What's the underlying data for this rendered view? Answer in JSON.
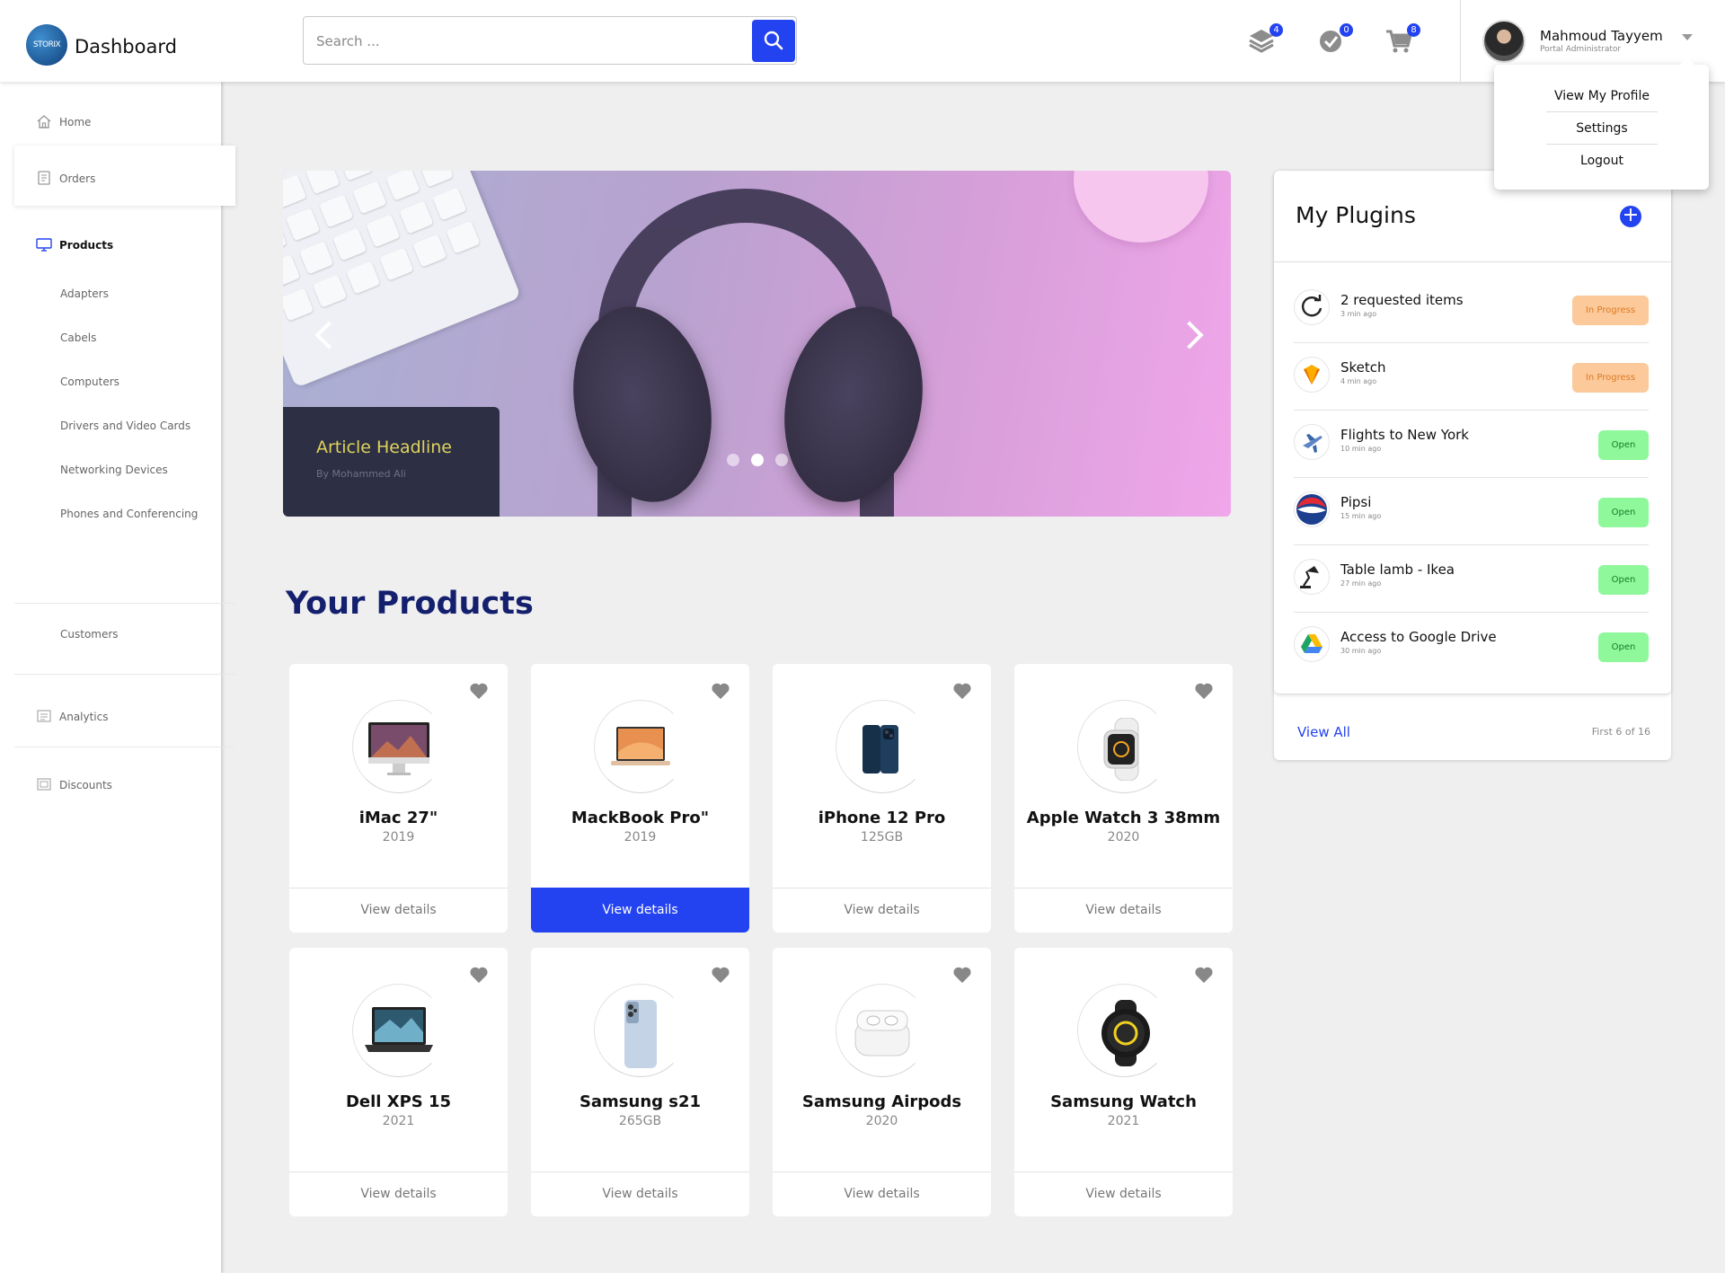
{
  "header": {
    "logo_text": "STORIX",
    "title": "Dashboard",
    "search": {
      "placeholder": "Search ...",
      "value": ""
    },
    "icons": [
      {
        "name": "layers-icon",
        "badge": "4"
      },
      {
        "name": "check-circle-icon",
        "badge": "0"
      },
      {
        "name": "cart-icon",
        "badge": "8"
      }
    ],
    "user": {
      "name": "Mahmoud Tayyem",
      "role": "Portal Administrator"
    }
  },
  "user_menu": {
    "items": [
      "View My Profile",
      "Settings",
      "Logout"
    ]
  },
  "sidebar": {
    "home": "Home",
    "orders": "Orders",
    "products": "Products",
    "product_categories": [
      "Adapters",
      "Cabels",
      "Computers",
      "Drivers and Video Cards",
      "Networking Devices",
      "Phones and Conferencing"
    ],
    "customers": "Customers",
    "analytics": "Analytics",
    "discounts": "Discounts"
  },
  "carousel": {
    "headline": "Article Headline",
    "byline": "By Mohammed Ali",
    "active_slide": 2,
    "slide_count": 3
  },
  "products": {
    "title": "Your Products",
    "view_label": "View details",
    "items": [
      {
        "name": "iMac 27\"",
        "sub": "2019",
        "icon": "imac-icon"
      },
      {
        "name": "MackBook Pro\"",
        "sub": "2019",
        "icon": "macbook-icon",
        "selected": true
      },
      {
        "name": "iPhone 12 Pro",
        "sub": "125GB",
        "icon": "iphone-icon"
      },
      {
        "name": "Apple Watch 3 38mm",
        "sub": "2020",
        "icon": "apple-watch-icon"
      },
      {
        "name": "Dell XPS 15",
        "sub": "2021",
        "icon": "laptop-icon"
      },
      {
        "name": "Samsung s21",
        "sub": "265GB",
        "icon": "samsung-phone-icon"
      },
      {
        "name": "Samsung Airpods",
        "sub": "2020",
        "icon": "airpods-icon"
      },
      {
        "name": "Samsung Watch",
        "sub": "2021",
        "icon": "samsung-watch-icon"
      }
    ]
  },
  "plugins": {
    "title": "My Plugins",
    "view_all": "View All",
    "count_text": "First 6 of 16",
    "items": [
      {
        "name": "2 requested items",
        "time": "3 min ago",
        "status": "In Progress",
        "icon": "refresh-icon"
      },
      {
        "name": "Sketch",
        "time": "4 min ago",
        "status": "In Progress",
        "icon": "sketch-icon"
      },
      {
        "name": "Flights to New York",
        "time": "10 min ago",
        "status": "Open",
        "icon": "airplane-icon"
      },
      {
        "name": "Pipsi",
        "time": "15 min ago",
        "status": "Open",
        "icon": "pepsi-icon"
      },
      {
        "name": "Table lamb - Ikea",
        "time": "27 min ago",
        "status": "Open",
        "icon": "lamp-icon"
      },
      {
        "name": "Access to Google Drive",
        "time": "30 min ago",
        "status": "Open",
        "icon": "google-drive-icon"
      }
    ]
  },
  "colors": {
    "accent": "#2443f0",
    "title": "#14206e",
    "in_progress": "#fbc99a",
    "open": "#8ef89a"
  }
}
